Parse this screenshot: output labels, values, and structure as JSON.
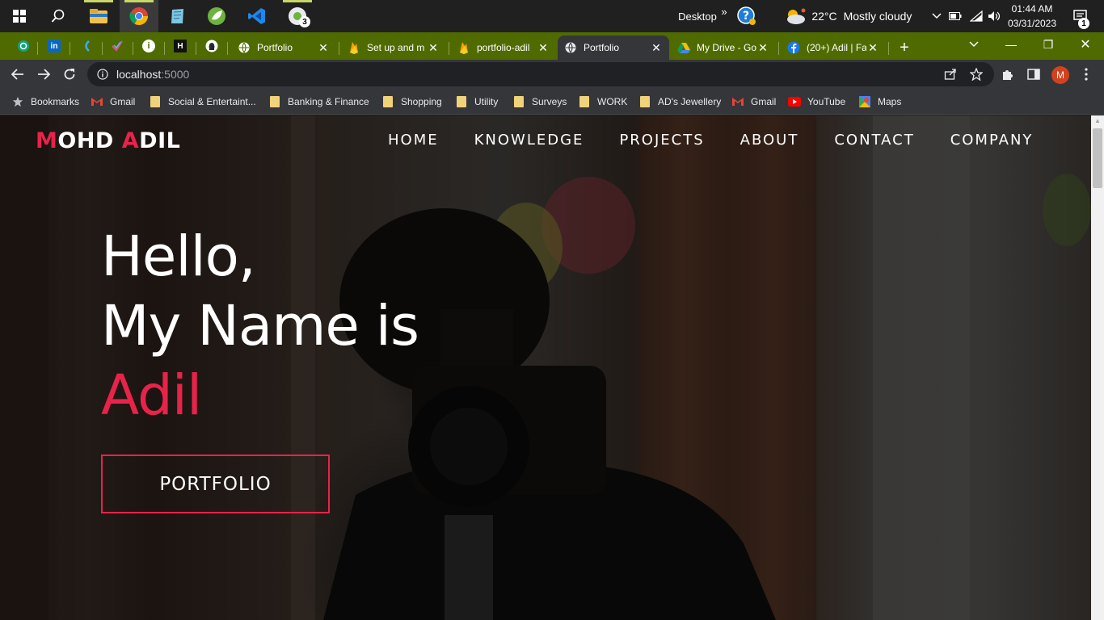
{
  "taskbar": {
    "desktop_label": "Desktop",
    "chevron": "»",
    "weather": {
      "temp": "22°C",
      "condition": "Mostly cloudy"
    },
    "clock": {
      "time": "01:44 AM",
      "date": "03/31/2023"
    },
    "notification_count": "1",
    "apps": [
      {
        "icon": "windows-start-icon"
      },
      {
        "icon": "search-icon"
      },
      {
        "icon": "file-explorer-icon"
      },
      {
        "icon": "chrome-icon"
      },
      {
        "icon": "notepad-icon"
      },
      {
        "icon": "spring-tool-icon"
      },
      {
        "icon": "vscode-icon"
      },
      {
        "icon": "chrome-profile-icon",
        "badge": "3"
      }
    ]
  },
  "tabs": {
    "pinned": [
      {
        "icon": "openai-icon"
      },
      {
        "icon": "linkedin-icon",
        "text": "in"
      },
      {
        "icon": "hackerrank-icon"
      },
      {
        "icon": "checkmark-icon"
      },
      {
        "icon": "info-icon",
        "text": "i"
      },
      {
        "icon": "hackerearth-icon",
        "text": "H"
      },
      {
        "icon": "github-icon"
      }
    ],
    "items": [
      {
        "title": "Portfolio",
        "icon": "globe-icon",
        "close": "✕"
      },
      {
        "title": "Set up and m",
        "icon": "firebase-icon",
        "close": "✕"
      },
      {
        "title": "portfolio-adil",
        "icon": "firebase-icon",
        "close": "✕"
      },
      {
        "title": "Portfolio",
        "icon": "globe-icon",
        "close": "✕",
        "active": true
      },
      {
        "title": "My Drive - Go",
        "icon": "google-drive-icon",
        "close": "✕"
      },
      {
        "title": "(20+) Adil | Fa",
        "icon": "facebook-icon",
        "close": "✕"
      }
    ],
    "new_tab": "+"
  },
  "window_controls": {
    "minimize": "—",
    "maximize": "❐",
    "close": "✕",
    "tab_search": "⌄"
  },
  "address_bar": {
    "host": "localhost",
    "port": ":5000"
  },
  "profile": {
    "initial": "M"
  },
  "bookmarks": [
    {
      "label": "Bookmarks",
      "icon": "star-icon"
    },
    {
      "label": "Gmail",
      "icon": "gmail-icon"
    },
    {
      "label": "Social & Entertaint...",
      "icon": "folder-icon"
    },
    {
      "label": "Banking & Finance",
      "icon": "folder-icon"
    },
    {
      "label": "Shopping",
      "icon": "folder-icon"
    },
    {
      "label": "Utility",
      "icon": "folder-icon"
    },
    {
      "label": "Surveys",
      "icon": "folder-icon"
    },
    {
      "label": "WORK",
      "icon": "folder-icon"
    },
    {
      "label": "AD's Jewellery",
      "icon": "folder-icon"
    },
    {
      "label": "Gmail",
      "icon": "gmail-icon"
    },
    {
      "label": "YouTube",
      "icon": "youtube-icon"
    },
    {
      "label": "Maps",
      "icon": "maps-icon"
    }
  ],
  "site": {
    "logo": {
      "first_initial": "M",
      "first_rest": "OHD ",
      "last_initial": "A",
      "last_rest": "DIL"
    },
    "nav": [
      "HOME",
      "KNOWLEDGE",
      "PROJECTS",
      "ABOUT",
      "CONTACT",
      "COMPANY"
    ],
    "hero": {
      "line1": "Hello,",
      "line2": "My Name is",
      "name": "Adil",
      "button": "PORTFOLIO"
    },
    "accent_color": "#e8234a"
  }
}
